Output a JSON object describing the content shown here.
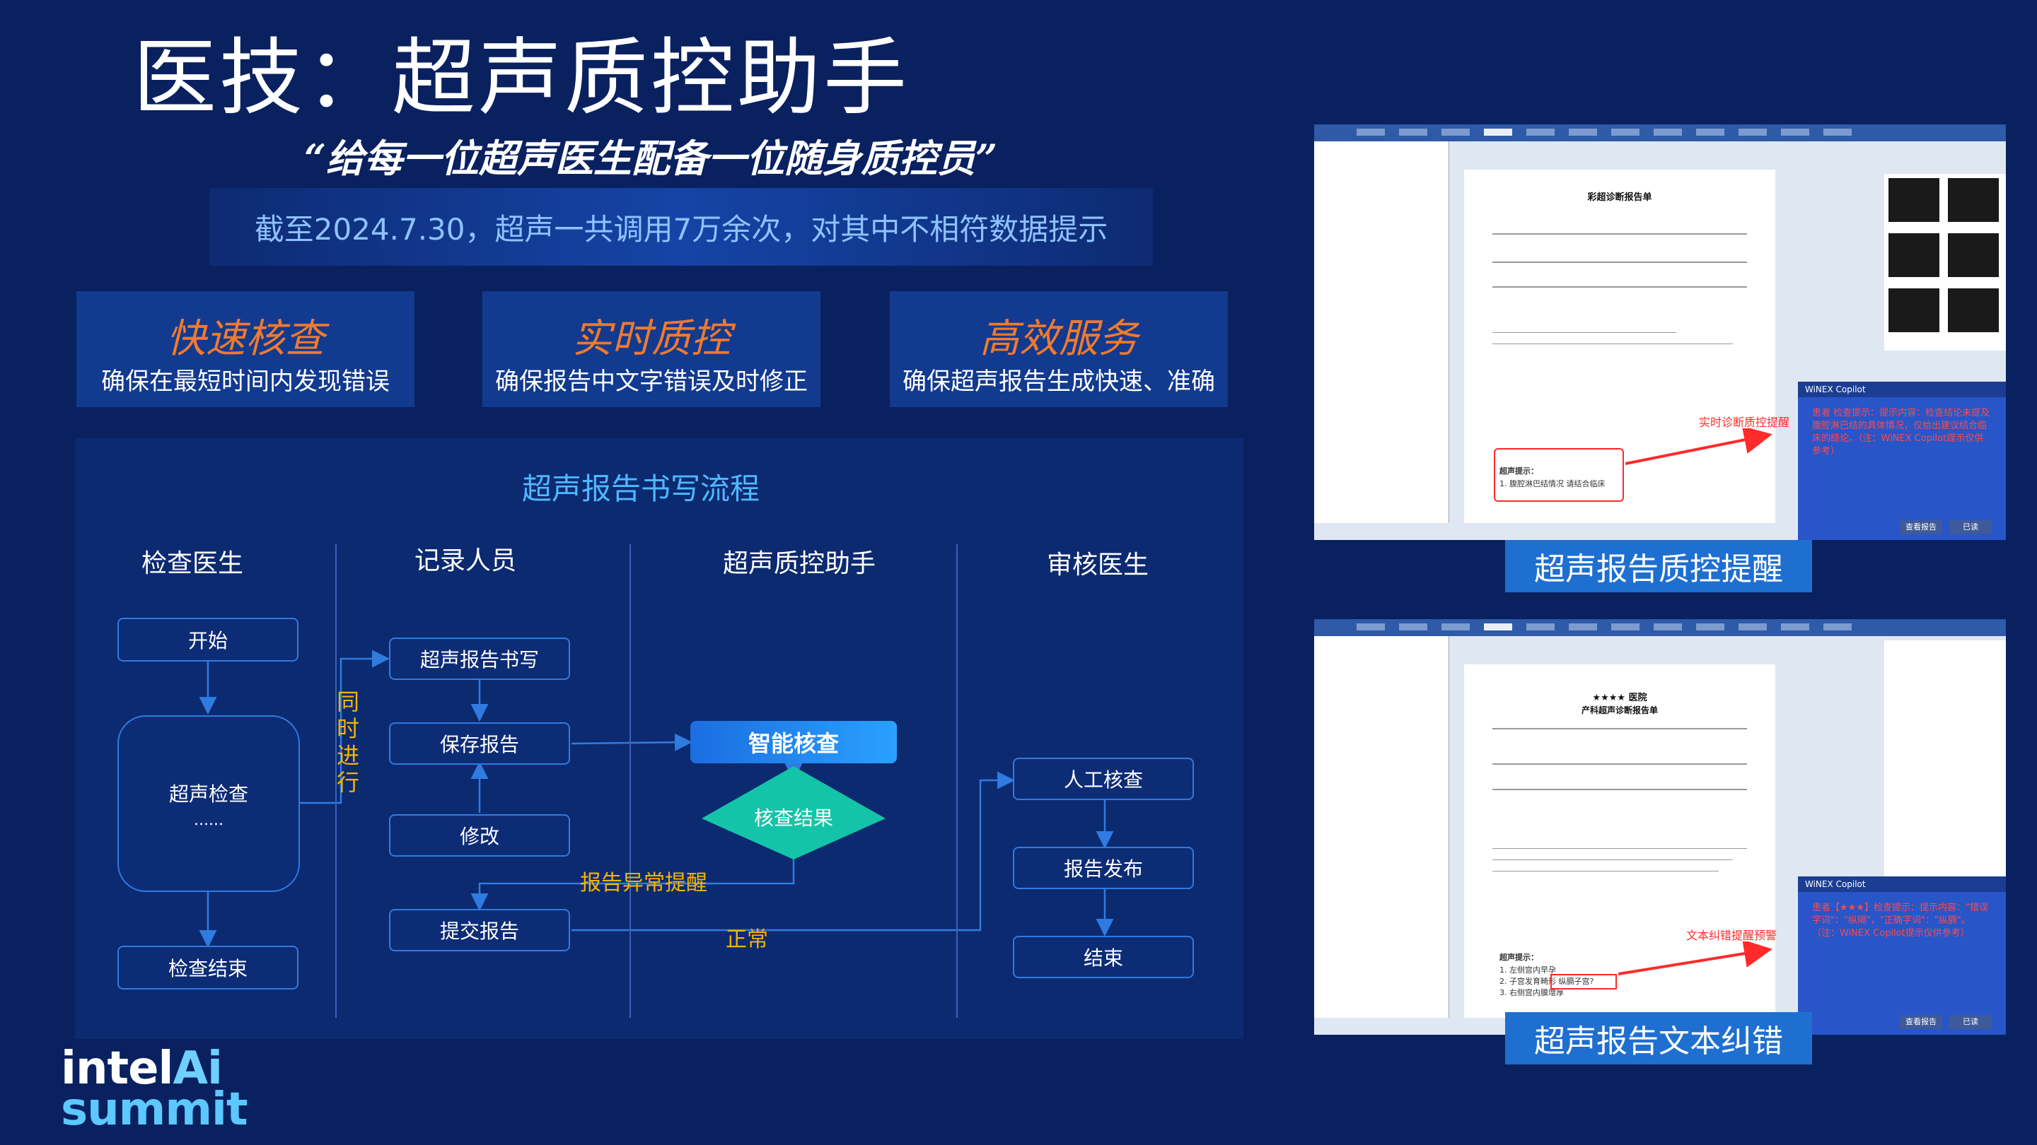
{
  "slide": {
    "title": "医技：超声质控助手",
    "slogan": "“给每一位超声医生配备一位随身质控员”",
    "stat": "截至2024.7.30，超声一共调用7万余次，对其中不相符数据提示"
  },
  "features": [
    {
      "title": "快速核查",
      "desc": "确保在最短时间内发现错误"
    },
    {
      "title": "实时质控",
      "desc": "确保报告中文字错误及时修正"
    },
    {
      "title": "高效服务",
      "desc": "确保超声报告生成快速、准确"
    }
  ],
  "flow": {
    "title": "超声报告书写流程",
    "lanes": [
      "检查医生",
      "记录人员",
      "超声质控助手",
      "审核医生"
    ],
    "nodes": {
      "start": "开始",
      "exam": "超声检查",
      "exam_more": "......",
      "exam_end": "检查结束",
      "write": "超声报告书写",
      "save": "保存报告",
      "modify": "修改",
      "submit": "提交报告",
      "smart": "智能核查",
      "result": "核查结果",
      "manual": "人工核查",
      "publish": "报告发布",
      "end": "结束"
    },
    "notes": {
      "parallel": [
        "同",
        "时",
        "进",
        "行"
      ],
      "abnormal": "报告异常提醒",
      "normal": "正常"
    }
  },
  "screens": [
    {
      "caption": "超声报告质控提醒",
      "report_title": "彩超诊断报告单",
      "red_label": "实时诊断质控提醒",
      "copilot": {
        "header": "WiNEX Copilot",
        "message": "患者       检查提示：提示内容：检查结论未提及腹腔淋巴结的具体情况，仅给出建议结合临床的结论。（注：WiNEX Copilot提示仅供参考）",
        "btn_view": "查看报告",
        "btn_read": "已读"
      },
      "hint_label": "超声提示：",
      "hint_line": "1. 腹腔淋巴结情况 请结合临床"
    },
    {
      "caption": "超声报告文本纠错",
      "hospital": "★★★★ 医院",
      "report_title": "产科超声诊断报告单",
      "red_label": "文本纠错提醒预警",
      "copilot": {
        "header": "WiNEX Copilot",
        "message": "患者【★★★】检查提示：提示内容：\"错误字词\"：\"纵隔\"，\"正确字词\"：\"纵膈\"。（注：WiNEX Copilot提示仅供参考）",
        "btn_view": "查看报告",
        "btn_read": "已读"
      },
      "hint_label": "超声提示：",
      "hint_lines": [
        "1. 左侧宫内早孕",
        "2. 子宫发育畸形 纵膈子宫?",
        "3. 右侧宫内膜增厚"
      ]
    }
  ],
  "logo": {
    "line1_a": "intel",
    "line1_b": "Ai",
    "line2": "summit"
  },
  "colors": {
    "background": "#0a2160",
    "accent_orange": "#f07a2e",
    "accent_yellow": "#f5b400",
    "accent_blue": "#4fb8ff",
    "caption_blue": "#1f6fd0",
    "diamond": "#14c4a8"
  }
}
